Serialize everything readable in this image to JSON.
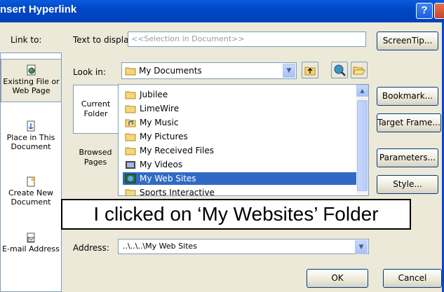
{
  "window": {
    "title": "nsert Hyperlink",
    "help_glyph": "?",
    "close_glyph": "X"
  },
  "link_to": {
    "label": "Link to:",
    "places": [
      {
        "name": "existing-file",
        "label_line1": "Existing File or",
        "label_line2": "Web Page",
        "icon": "globe-page-icon"
      },
      {
        "name": "place-in-doc",
        "label_line1": "Place in This",
        "label_line2": "Document",
        "icon": "document-anchor-icon"
      },
      {
        "name": "create-new",
        "label_line1": "Create New",
        "label_line2": "Document",
        "icon": "new-document-icon"
      },
      {
        "name": "email",
        "label_line1": "E-mail Address",
        "label_line2": "",
        "icon": "envelope-icon"
      }
    ]
  },
  "text_to_display": {
    "label": "Text to display:",
    "value": "<<Selection in Document>>"
  },
  "look_in": {
    "label": "Look in:",
    "value": "My Documents"
  },
  "subtabs": [
    {
      "line1": "Current",
      "line2": "Folder"
    },
    {
      "line1": "Browsed",
      "line2": "Pages"
    }
  ],
  "files": [
    {
      "name": "Jubilee",
      "icon": "folder-icon"
    },
    {
      "name": "LimeWire",
      "icon": "folder-icon"
    },
    {
      "name": "My Music",
      "icon": "music-folder-icon"
    },
    {
      "name": "My Pictures",
      "icon": "folder-icon"
    },
    {
      "name": "My Received Files",
      "icon": "folder-icon"
    },
    {
      "name": "My Videos",
      "icon": "video-folder-icon"
    },
    {
      "name": "My Web Sites",
      "icon": "web-folder-icon",
      "selected": true
    },
    {
      "name": "Sports Interactive",
      "icon": "folder-icon"
    }
  ],
  "address": {
    "label": "Address:",
    "value": "..\\..\\..\\My Web Sites"
  },
  "buttons": {
    "screentip": "ScreenTip...",
    "bookmark": "Bookmark...",
    "target_frame": "Target Frame...",
    "parameters": "Parameters...",
    "style": "Style...",
    "ok": "OK",
    "cancel": "Cancel"
  },
  "annotation": "I clicked on ‘My Websites’ Folder"
}
